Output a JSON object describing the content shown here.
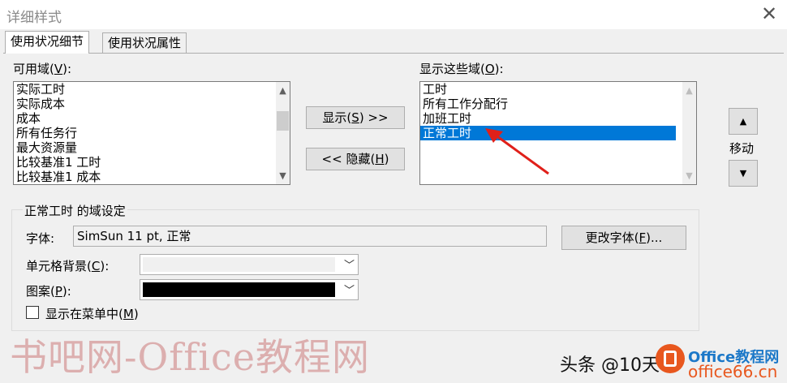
{
  "window": {
    "title": "详细样式"
  },
  "tabs": [
    {
      "label": "使用状况细节",
      "active": true
    },
    {
      "label": "使用状况属性",
      "active": false
    }
  ],
  "available_fields": {
    "label_prefix": "可用域(",
    "label_key": "V",
    "label_suffix": "):",
    "items": [
      "实际工时",
      "实际成本",
      "成本",
      "所有任务行",
      "最大资源量",
      "比较基准1 工时",
      "比较基准1 成本"
    ]
  },
  "shown_fields": {
    "label_prefix": "显示这些域(",
    "label_key": "O",
    "label_suffix": "):",
    "items": [
      "工时",
      "所有工作分配行",
      "加班工时",
      "正常工时"
    ],
    "selected_index": 3
  },
  "buttons": {
    "show": {
      "prefix": "显示(",
      "key": "S",
      "suffix": ") >>"
    },
    "hide": {
      "prefix": "<< 隐藏(",
      "key": "H",
      "suffix": ")"
    },
    "move_label": "移动",
    "change_font": {
      "prefix": "更改字体(",
      "key": "F",
      "suffix": ")..."
    }
  },
  "settings": {
    "group_title": "正常工时 的域设定",
    "font_label": "字体:",
    "font_value": "SimSun 11 pt, 正常",
    "cell_bg_prefix": "单元格背景(",
    "cell_bg_key": "C",
    "cell_bg_suffix": "):",
    "pattern_prefix": "图案(",
    "pattern_key": "P",
    "pattern_suffix": "):",
    "show_in_menu_prefix": "显示在菜单中(",
    "show_in_menu_key": "M",
    "show_in_menu_suffix": ")",
    "show_in_menu_checked": false
  },
  "overlay": {
    "watermark": "书吧网-Office教程网",
    "attribution": "头条 @10天",
    "site_logo": "Office教程网",
    "site_url": "office66.cn"
  },
  "colors": {
    "selection": "#0078d7",
    "pattern_black": "#000000",
    "cell_bg_gray": "#f0f0f0",
    "arrow": "#e0201a"
  }
}
